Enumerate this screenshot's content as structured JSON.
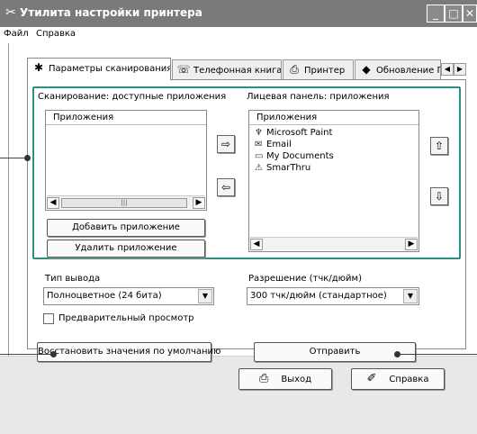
{
  "window": {
    "title": "Утилита настройки принтера",
    "app_icon": "printer-settings-icon",
    "controls": [
      "minimize",
      "maximize",
      "close"
    ]
  },
  "menu": [
    "Файл",
    "Справка"
  ],
  "tabs": [
    {
      "label": "Параметры сканирования",
      "icon": "scan-icon",
      "active": true
    },
    {
      "label": "Телефонная книга",
      "icon": "phonebook-icon"
    },
    {
      "label": "Принтер",
      "icon": "printer-icon"
    },
    {
      "label": "Обновление ПО",
      "icon": "update-icon"
    }
  ],
  "left_group": {
    "title": "Сканирование: доступные приложения",
    "list_header": "Приложения",
    "items": [],
    "add_button": "Добавить приложение",
    "remove_button": "Удалить приложение"
  },
  "right_group": {
    "title": "Лицевая панель: приложения",
    "list_header": "Приложения",
    "items": [
      {
        "label": "Microsoft Paint",
        "icon": "paint-icon"
      },
      {
        "label": "Email",
        "icon": "email-icon"
      },
      {
        "label": "My Documents",
        "icon": "folder-icon"
      },
      {
        "label": "SmarThru",
        "icon": "smarthru-icon"
      }
    ]
  },
  "output": {
    "type_label": "Тип вывода",
    "type_value": "Полноцветное (24 бита)",
    "resolution_label": "Разрешение (тчк/дюйм)",
    "resolution_value": "300 тчк/дюйм (стандартное)",
    "preview_label": "Предварительный просмотр",
    "preview_checked": false
  },
  "actions": {
    "defaults_button": "Восстановить значения по умолчанию",
    "send_button": "Отправить"
  },
  "footer": {
    "exit_button": "Выход",
    "help_button": "Справка"
  }
}
